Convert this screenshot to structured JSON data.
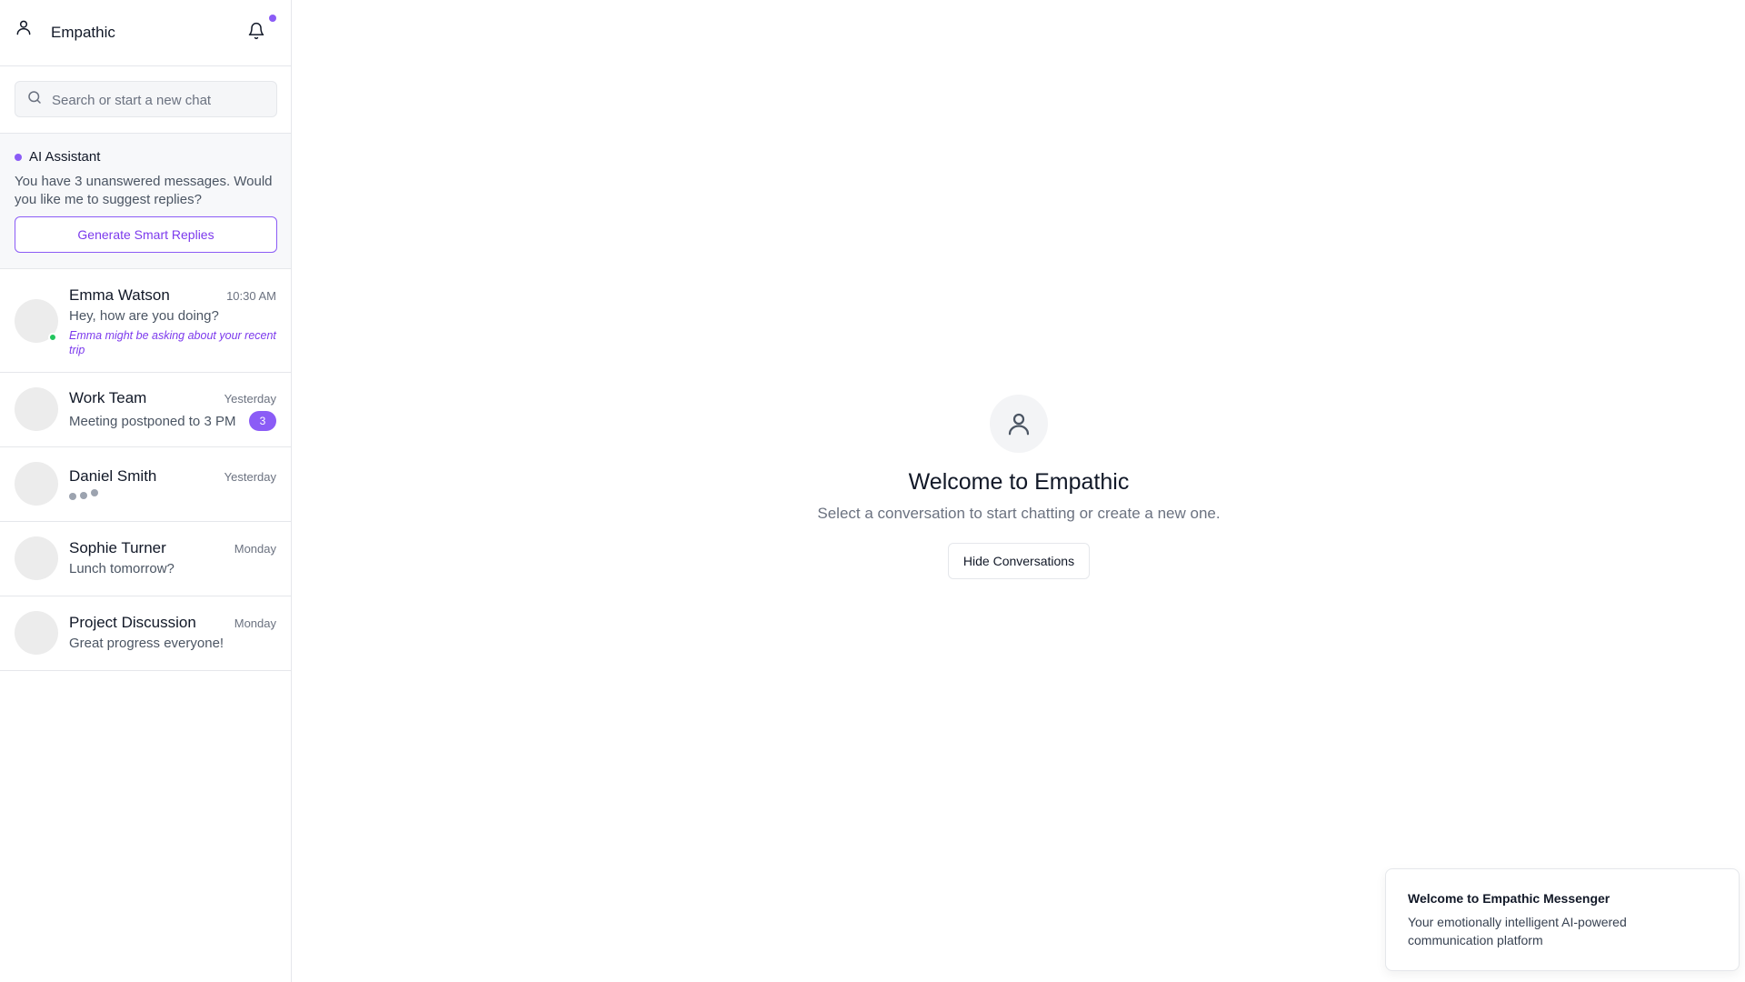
{
  "sidebar": {
    "app_title": "Empathic",
    "search": {
      "placeholder": "Search or start a new chat"
    },
    "ai_assistant": {
      "title": "AI Assistant",
      "message": "You have 3 unanswered messages. Would you like me to suggest replies?",
      "button_label": "Generate Smart Replies"
    },
    "conversations": [
      {
        "name": "Emma Watson",
        "time": "10:30 AM",
        "message": "Hey, how are you doing?",
        "hint": "Emma might be asking about your recent trip",
        "online": true
      },
      {
        "name": "Work Team",
        "time": "Yesterday",
        "message": "Meeting postponed to 3 PM",
        "unread": "3"
      },
      {
        "name": "Daniel Smith",
        "time": "Yesterday",
        "typing": true
      },
      {
        "name": "Sophie Turner",
        "time": "Monday",
        "message": "Lunch tomorrow?"
      },
      {
        "name": "Project Discussion",
        "time": "Monday",
        "message": "Great progress everyone!"
      }
    ]
  },
  "main": {
    "welcome_title": "Welcome to Empathic",
    "welcome_subtitle": "Select a conversation to start chatting or create a new one.",
    "hide_button_label": "Hide Conversations"
  },
  "toast": {
    "title": "Welcome to Empathic Messenger",
    "body": "Your emotionally intelligent AI-powered communication platform"
  },
  "colors": {
    "accent": "#8b5cf6",
    "online": "#22c55e",
    "border": "#e5e7eb"
  },
  "icons": [
    "user-icon",
    "bell-icon",
    "search-icon"
  ]
}
